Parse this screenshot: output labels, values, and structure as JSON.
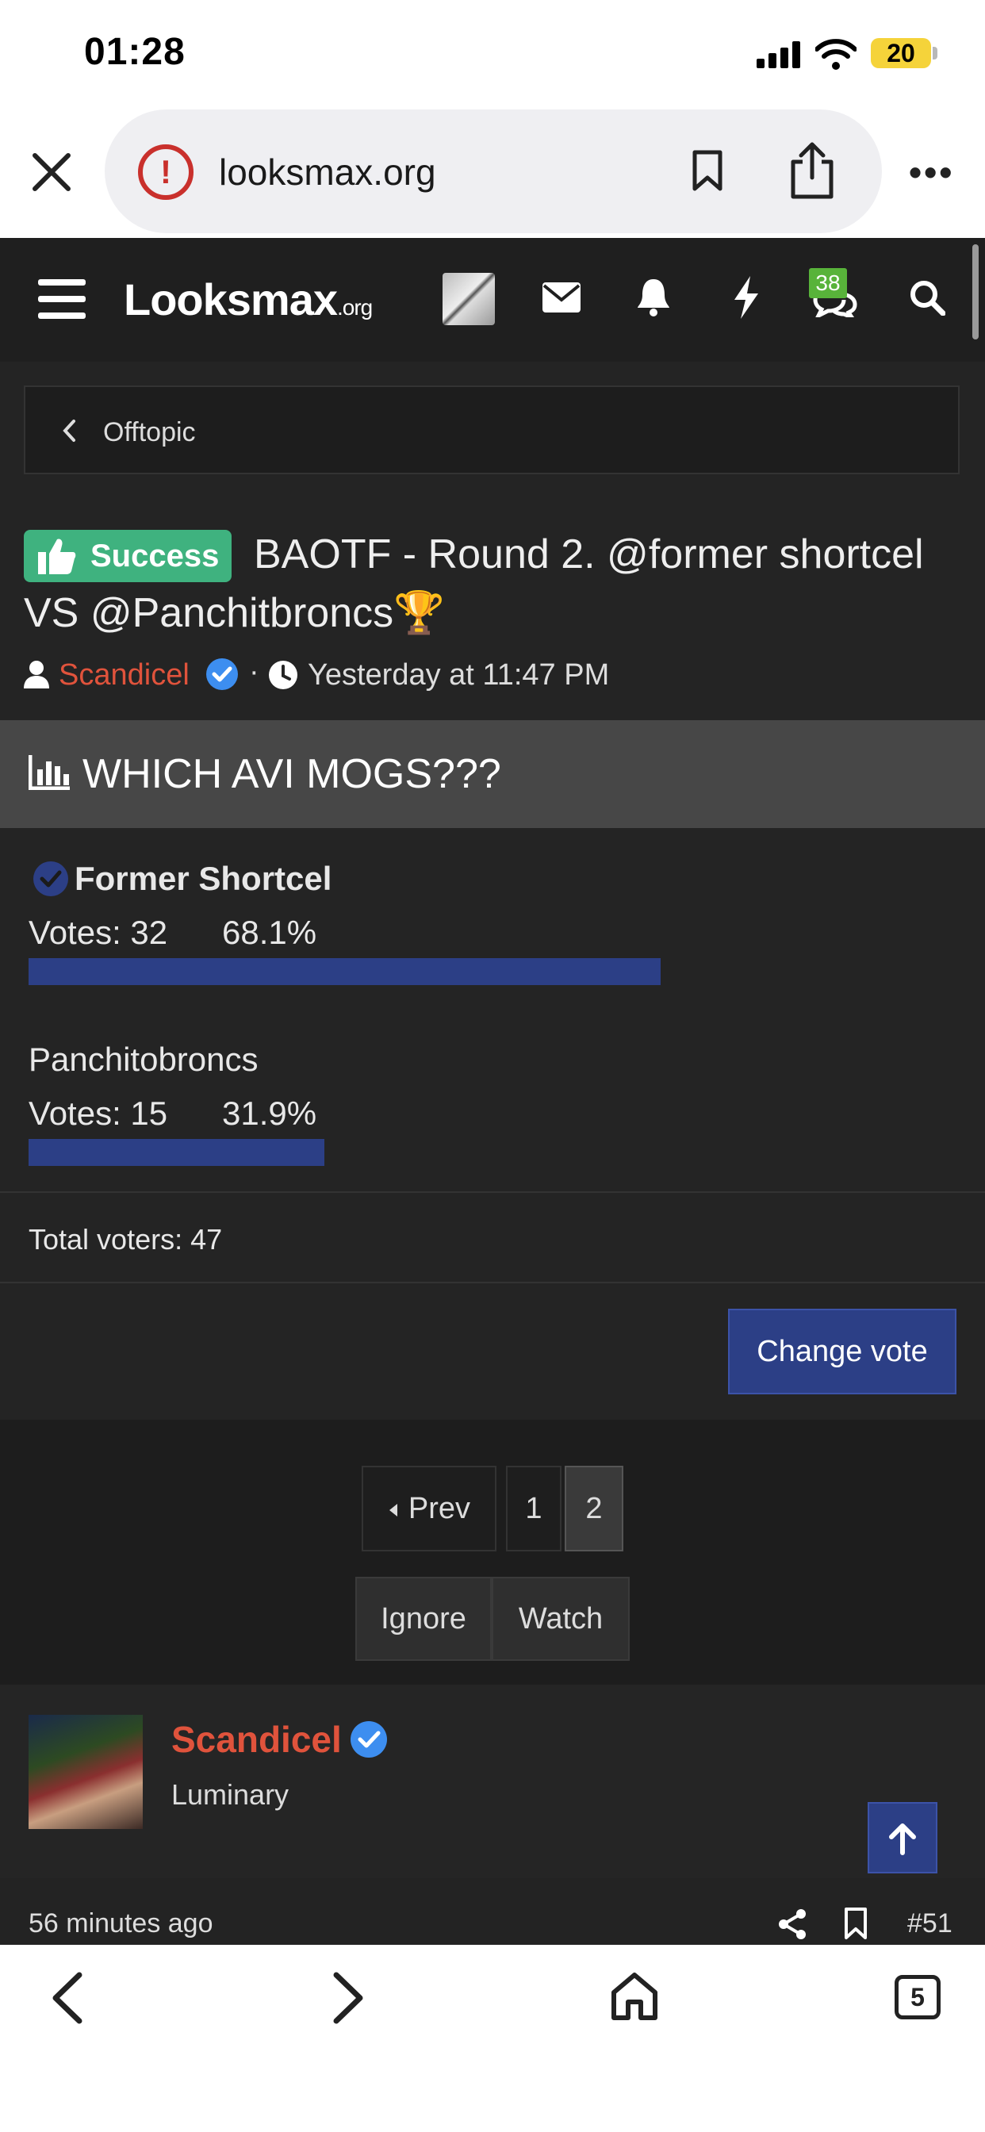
{
  "status_bar": {
    "time": "01:28",
    "battery": "20"
  },
  "browser": {
    "url": "looksmax.org"
  },
  "nav": {
    "logo": "Looksmax",
    "logo_suffix": ".org",
    "chat_badge": "38"
  },
  "breadcrumb": {
    "label": "Offtopic"
  },
  "thread": {
    "prefix": "Success",
    "title": "BAOTF - Round 2. @former shortcel VS @Panchitbroncs🏆",
    "author": "Scandicel",
    "time": "Yesterday at 11:47 PM"
  },
  "poll": {
    "title": "WHICH AVI MOGS???",
    "options": [
      {
        "name": "Former Shortcel",
        "votes_label": "Votes: 32",
        "percent_label": "68.1%",
        "fraction": 0.681,
        "voted": true
      },
      {
        "name": "Panchitobroncs",
        "votes_label": "Votes: 15",
        "percent_label": "31.9%",
        "fraction": 0.319,
        "voted": false
      }
    ],
    "total": "Total voters: 47",
    "change_vote": "Change vote"
  },
  "pagination": {
    "prev": "Prev",
    "pages": [
      "1",
      "2"
    ],
    "current": "2"
  },
  "thread_actions": {
    "ignore": "Ignore",
    "watch": "Watch"
  },
  "post": {
    "user": "Scandicel",
    "rank": "Luminary",
    "age": "56 minutes ago",
    "number": "#51"
  },
  "bottom_bar": {
    "tabs_count": "5"
  }
}
